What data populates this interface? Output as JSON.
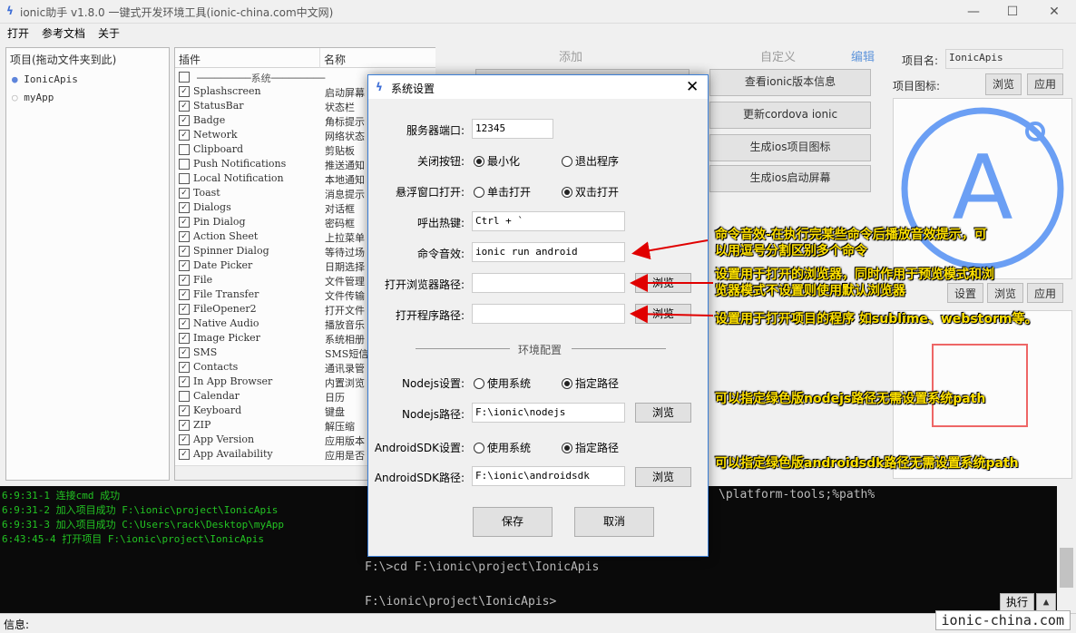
{
  "window": {
    "title": "ionic助手 v1.8.0 一键式开发环境工具(ionic-china.com中文网)"
  },
  "menu": [
    "打开",
    "参考文档",
    "关于"
  ],
  "project_panel": {
    "header": "项目(拖动文件夹到此)",
    "items": [
      "IonicApis",
      "myApp"
    ]
  },
  "plugins": {
    "col_plugin": "插件",
    "col_name": "名称",
    "group": "系统",
    "rows": [
      {
        "name": "Splashscreen",
        "desc": "启动屏幕",
        "checked": true
      },
      {
        "name": "StatusBar",
        "desc": "状态栏",
        "checked": true
      },
      {
        "name": "Badge",
        "desc": "角标提示",
        "checked": true
      },
      {
        "name": "Network",
        "desc": "网络状态",
        "checked": true
      },
      {
        "name": "Clipboard",
        "desc": "剪贴板",
        "checked": false
      },
      {
        "name": "Push Notifications",
        "desc": "推送通知",
        "checked": false
      },
      {
        "name": "Local Notification",
        "desc": "本地通知",
        "checked": false
      },
      {
        "name": "Toast",
        "desc": "消息提示",
        "checked": true
      },
      {
        "name": "Dialogs",
        "desc": "对话框",
        "checked": true
      },
      {
        "name": "Pin Dialog",
        "desc": "密码框",
        "checked": true
      },
      {
        "name": "Action Sheet",
        "desc": "上拉菜单",
        "checked": true
      },
      {
        "name": "Spinner Dialog",
        "desc": "等待过场",
        "checked": true
      },
      {
        "name": "Date Picker",
        "desc": "日期选择",
        "checked": true
      },
      {
        "name": "File",
        "desc": "文件管理",
        "checked": true
      },
      {
        "name": "File Transfer",
        "desc": "文件传输",
        "checked": true
      },
      {
        "name": "FileOpener2",
        "desc": "打开文件",
        "checked": true
      },
      {
        "name": "Native Audio",
        "desc": "播放音乐",
        "checked": true
      },
      {
        "name": "Image Picker",
        "desc": "系统相册",
        "checked": true
      },
      {
        "name": "SMS",
        "desc": "SMS短信",
        "checked": true
      },
      {
        "name": "Contacts",
        "desc": "通讯录管",
        "checked": true
      },
      {
        "name": "In App Browser",
        "desc": "内置浏览",
        "checked": true
      },
      {
        "name": "Calendar",
        "desc": "日历",
        "checked": false
      },
      {
        "name": "Keyboard",
        "desc": "键盘",
        "checked": true
      },
      {
        "name": "ZIP",
        "desc": "解压缩",
        "checked": true
      },
      {
        "name": "App Version",
        "desc": "应用版本",
        "checked": true
      },
      {
        "name": "App Availability",
        "desc": "应用是否",
        "checked": true
      }
    ]
  },
  "right_panel": {
    "group_add": "添加",
    "group_custom": "自定义",
    "edit_link": "编辑",
    "buttons": [
      "查看ionic版本信息",
      "更新cordova ionic",
      "生成ios项目图标",
      "生成ios启动屏幕"
    ],
    "project_name_label": "项目名:",
    "project_name_value": "IonicApis",
    "project_icon_label": "项目图标:",
    "browse": "浏览",
    "apply": "应用",
    "icon_letter": "A",
    "set_label": "设置"
  },
  "console_left": {
    "lines": [
      "6:9:31-1 连接cmd 成功",
      "6:9:31-2 加入项目成功 F:\\ionic\\project\\IonicApis",
      "6:9:31-3 加入项目成功 C:\\Users\\rack\\Desktop\\myApp",
      "6:43:45-4 打开项目 F:\\ionic\\project\\IonicApis"
    ]
  },
  "console_right": {
    "lines": [
      "\\platform-tools;%path%",
      "F:\\>cd F:\\ionic\\project\\IonicApis",
      "F:\\ionic\\project\\IonicApis>"
    ],
    "exec_button": "执行"
  },
  "status_bar": {
    "label": "信息:"
  },
  "watermark": "ionic-china.com",
  "dialog": {
    "title": "系统设置",
    "port_label": "服务器端口:",
    "port_value": "12345",
    "close_label": "关闭按钮:",
    "close_opt1": "最小化",
    "close_opt2": "退出程序",
    "float_label": "悬浮窗口打开:",
    "float_opt1": "单击打开",
    "float_opt2": "双击打开",
    "hotkey_label": "呼出热键:",
    "hotkey_value": "Ctrl + `",
    "sound_label": "命令音效:",
    "sound_value": "ionic run android",
    "browser_label": "打开浏览器路径:",
    "browser_value": "",
    "program_label": "打开程序路径:",
    "program_value": "",
    "browse": "浏览",
    "env_section": "环境配置",
    "node_label": "Nodejs设置:",
    "node_opt1": "使用系统",
    "node_opt2": "指定路径",
    "nodepath_label": "Nodejs路径:",
    "nodepath_value": "F:\\ionic\\nodejs",
    "sdk_label": "AndroidSDK设置:",
    "sdk_opt1": "使用系统",
    "sdk_opt2": "指定路径",
    "sdkpath_label": "AndroidSDK路径:",
    "sdkpath_value": "F:\\ionic\\androidsdk",
    "save": "保存",
    "cancel": "取消"
  },
  "annotations": {
    "sound_1": "命令音效-在执行完某些命令后播放音效提示，可",
    "sound_2": "以用逗号分割区别多个命令",
    "browser_1": "设置用于打开的浏览器，同时作用于预览模式和浏",
    "browser_2": "览器模式不设置则使用默认浏览器",
    "program": "设置用于打开项目的程序 如sublime、webstorm等。",
    "node": "可以指定绿色版nodejs路径无需设置系统path",
    "sdk": "可以指定绿色版androidsdk路径无需设置系统path"
  },
  "colors": {
    "accent": "#3c7fd6",
    "annotation": "#ffe100",
    "arrow": "#e00000",
    "console_green": "#23c323"
  }
}
